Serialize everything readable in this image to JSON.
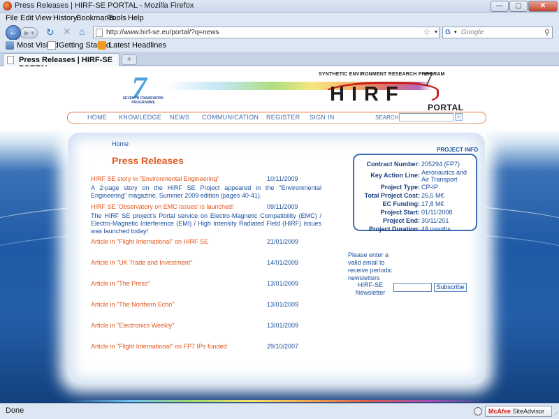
{
  "window": {
    "title": "Press Releases | HIRF-SE PORTAL - Mozilla Firefox",
    "minimize": "—",
    "maximize": "▢",
    "close": "✕"
  },
  "menu": [
    "File",
    "Edit",
    "View",
    "History",
    "Bookmarks",
    "Tools",
    "Help"
  ],
  "navbar": {
    "url": "http://www.hirf-se.eu/portal/?q=news",
    "search_placeholder": "Google"
  },
  "bookmarks": [
    "Most Visited",
    "Getting Started",
    "Latest Headlines"
  ],
  "tab": {
    "label": "Press Releases | HIRF-SE PORTAL",
    "new_tab": "+"
  },
  "header": {
    "fp7_seven": "7",
    "fp7_text": "SEVENTH FRAMEWORK PROGRAMME",
    "program": "SYNTHETIC ENVIRONMENT RESEARCH PROGRAM",
    "logo": "HIRF",
    "logo_seven": "7",
    "portal": "PORTAL"
  },
  "site_nav": {
    "items": [
      "HOME",
      "KNOWLEDGE",
      "NEWS",
      "COMMUNICATION",
      "REGISTER",
      "SIGN IN"
    ],
    "search_label": "SEARCH",
    "search_go": "›"
  },
  "page": {
    "breadcrumb": "Home",
    "title": "Press Releases",
    "project_info_label": "PROJECT INFO"
  },
  "news": [
    {
      "title": "HIRF SE story in \"Environmental Engineering\"",
      "date": "10/11/2009",
      "desc": "A 2-page story on the HIRF SE Project appeared in the \"Environmental Engineering\" magazine, Summer 2009 edition (pages 40-41)."
    },
    {
      "title": "HIRF SE 'Observatory on EMC Issues' is launched!",
      "date": "09/11/2009",
      "desc": "The HIRF SE project's Portal service on Electro-Magnetic Compatibility (EMC) / Electro-Magnetic Interference (EMI) / High Intensity Radiated Field (HIRF) issues was launched today!"
    },
    {
      "title": "Article in \"Flight International\" on HIRF SE",
      "date": "21/01/2009",
      "desc": ""
    },
    {
      "title": "Article in \"UK Trade and Investment\"",
      "date": "14/01/2009",
      "desc": ""
    },
    {
      "title": "Article in \"The Press\"",
      "date": "13/01/2009",
      "desc": ""
    },
    {
      "title": "Article in \"The Northern Echo\"",
      "date": "13/01/2009",
      "desc": ""
    },
    {
      "title": "Article in \"Electronics Weekly\"",
      "date": "13/01/2009",
      "desc": ""
    },
    {
      "title": "Article in \"Flight International\" on FP7 IPs funded",
      "date": "29/10/2007",
      "desc": ""
    }
  ],
  "project_info": [
    {
      "key": "Contract Number:",
      "value": "205294 (FP7)"
    },
    {
      "key": "Key Action Line:",
      "value": "Aeronautics and Air Transport"
    },
    {
      "key": "Project Type:",
      "value": "CP-IP"
    },
    {
      "key": "Total Project Cost:",
      "value": "26,5 M€"
    },
    {
      "key": "EC Funding:",
      "value": "17,8 M€"
    },
    {
      "key": "Project Start:",
      "value": "01/11/2008"
    },
    {
      "key": "Project End:",
      "value": "30/11/201"
    },
    {
      "key": "Project Duration:",
      "value": "48 months"
    }
  ],
  "newsletter": {
    "prompt": "Please enter a valid email to receive periodic newsletters",
    "label": "HIRF-SE Newsletter",
    "button": "Subscribe"
  },
  "statusbar": {
    "status": "Done",
    "mcafee_brand": "McAfee",
    "mcafee_rest": " SiteAdvisor"
  },
  "colors": {
    "accent": "#e0561b",
    "link": "#1a4f9c",
    "frame": "#3a6fb8"
  }
}
